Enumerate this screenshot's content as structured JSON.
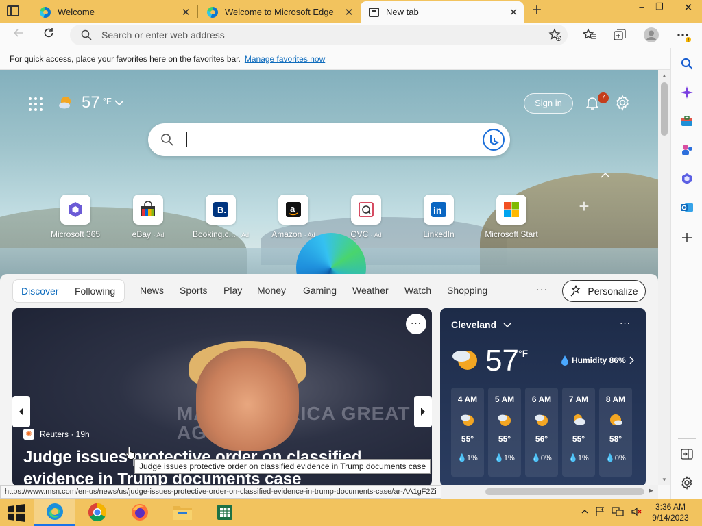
{
  "browser": {
    "tabs": [
      {
        "label": "Welcome",
        "active": false
      },
      {
        "label": "Welcome to Microsoft Edge",
        "active": false
      },
      {
        "label": "New tab",
        "active": true
      }
    ],
    "new_tab_symbol": "+",
    "close_symbol": "✕",
    "window_controls": {
      "minimize": "–",
      "restore": "❐",
      "close": "✕"
    },
    "address_placeholder": "Search or enter web address",
    "favorites_bar": {
      "message": "For quick access, place your favorites here on the favorites bar.",
      "link": "Manage favorites now"
    },
    "sidebar_icons": [
      "search-icon",
      "copilot-icon",
      "shopping-icon",
      "games-icon",
      "microsoft365-icon",
      "outlook-icon",
      "add-icon",
      "collapse-sidebar-icon",
      "settings-icon"
    ]
  },
  "ntp": {
    "weather": {
      "temp": "57",
      "unit": "°F"
    },
    "sign_in": "Sign in",
    "notification_count": "7",
    "quick_links": [
      {
        "label": "Microsoft 365",
        "ad": "",
        "icon": "microsoft365-icon"
      },
      {
        "label": "eBay",
        "ad": "· Ad",
        "icon": "ebay-icon"
      },
      {
        "label": "Booking.c...",
        "ad": "· Ad",
        "icon": "booking-icon"
      },
      {
        "label": "Amazon",
        "ad": "· Ad",
        "icon": "amazon-icon"
      },
      {
        "label": "QVC",
        "ad": "· Ad",
        "icon": "qvc-icon"
      },
      {
        "label": "LinkedIn",
        "ad": "",
        "icon": "linkedin-icon"
      },
      {
        "label": "Microsoft Start",
        "ad": "",
        "icon": "microsoft-start-icon"
      }
    ]
  },
  "feed": {
    "segment": [
      "Discover",
      "Following"
    ],
    "categories": [
      "News",
      "Sports",
      "Play",
      "Money",
      "Gaming",
      "Weather",
      "Watch",
      "Shopping"
    ],
    "more": "···",
    "personalize": "Personalize",
    "hero": {
      "source": "Reuters · 19h",
      "headline": "Judge issues protective order on classified evidence in Trump documents case",
      "image_banner": "MAKE AMERICA GREAT AGAIN!"
    },
    "weather_card": {
      "city": "Cleveland",
      "temp": "57",
      "unit": "°F",
      "humidity": "Humidity 86%",
      "hours": [
        {
          "time": "4 AM",
          "temp": "55°",
          "precip": "1%"
        },
        {
          "time": "5 AM",
          "temp": "55°",
          "precip": "1%"
        },
        {
          "time": "6 AM",
          "temp": "56°",
          "precip": "0%"
        },
        {
          "time": "7 AM",
          "temp": "55°",
          "precip": "1%"
        },
        {
          "time": "8 AM",
          "temp": "58°",
          "precip": "0%"
        }
      ]
    }
  },
  "status": {
    "url": "https://www.msn.com/en-us/news/us/judge-issues-protective-order-on-classified-evidence-in-trump-documents-case/ar-AA1gF2Zi",
    "tooltip": "Judge issues protective order on classified evidence in Trump documents case"
  },
  "taskbar": {
    "apps": [
      "edge-icon",
      "chrome-icon",
      "firefox-icon",
      "file-explorer-icon",
      "excel-icon"
    ],
    "time": "3:36 AM",
    "date": "9/14/2023"
  },
  "colors": {
    "accent": "#f2c35e",
    "link": "#0f6cbd",
    "badge": "#c43e1c"
  }
}
